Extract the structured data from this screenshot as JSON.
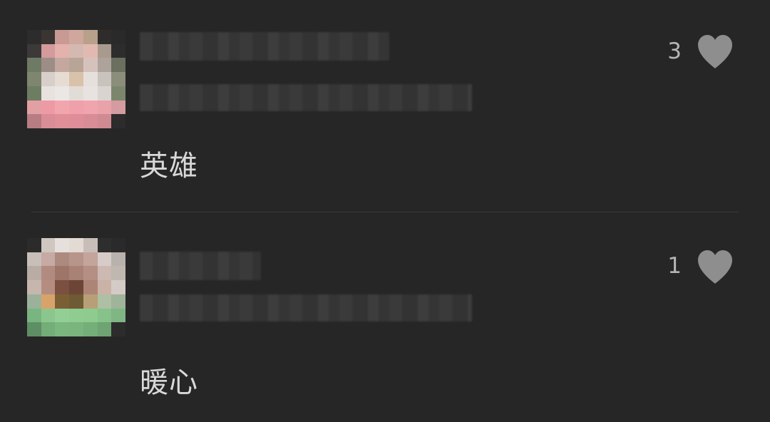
{
  "comments": [
    {
      "text": "英雄",
      "likes": "3",
      "like_icon": "heart-icon"
    },
    {
      "text": "暖心",
      "likes": "1",
      "like_icon": "heart-icon"
    }
  ],
  "colors": {
    "background": "#262627",
    "text": "#d8d8d8",
    "like_count": "#b5b5b5",
    "heart": "#8e8e8e",
    "divider": "#3a3a3b"
  }
}
